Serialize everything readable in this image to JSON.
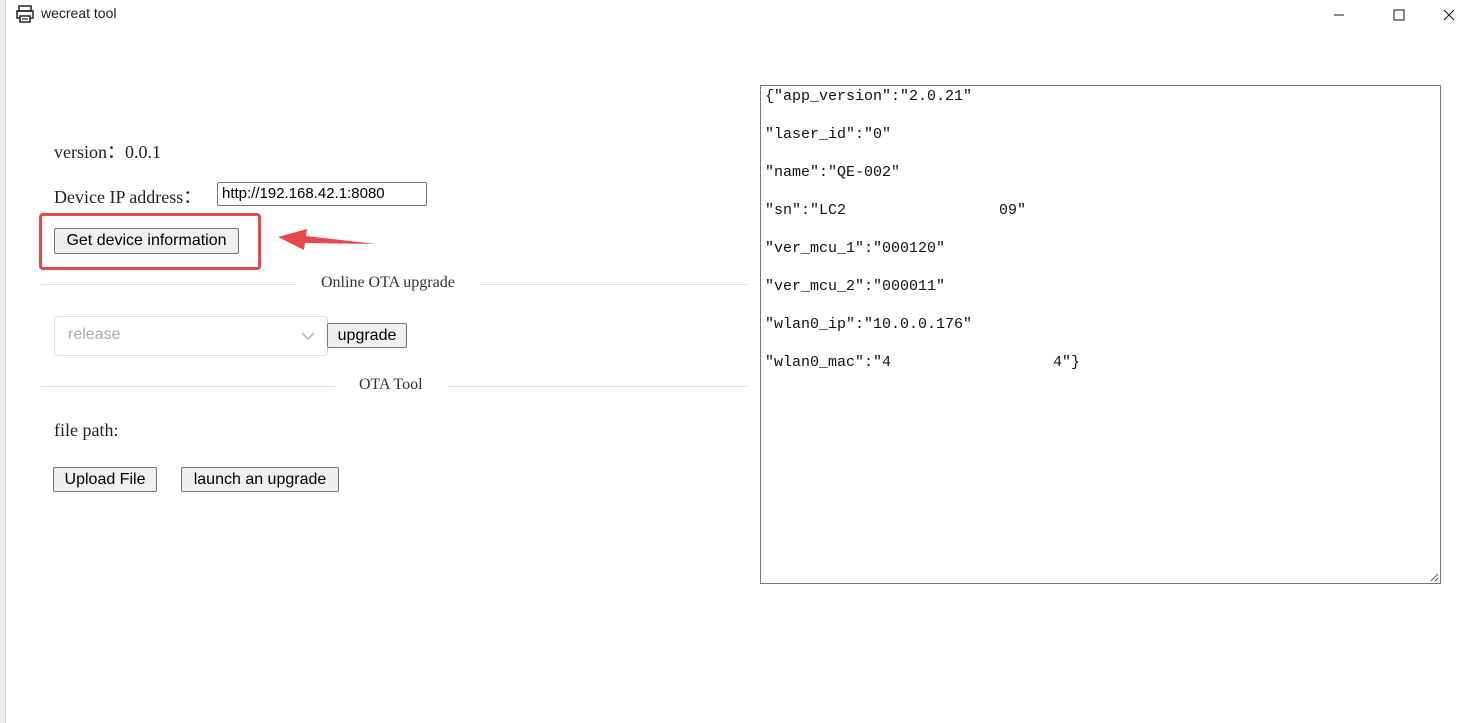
{
  "window": {
    "title": "wecreat tool"
  },
  "main": {
    "version_text": "version：0.0.1",
    "ip_label": "Device IP address：",
    "ip_value": "http://192.168.42.1:8080",
    "get_info_label": "Get device information",
    "online_ota_title": "Online OTA upgrade",
    "channel_select_value": "release",
    "upgrade_label": "upgrade",
    "ota_tool_title": "OTA Tool",
    "file_path_label": "file path:",
    "upload_label": "Upload File",
    "launch_label": "launch an upgrade"
  },
  "device_info": {
    "lines": [
      "{\"app_version\":\"2.0.21\"",
      "\"laser_id\":\"0\"",
      "\"name\":\"QE-002\"",
      "\"sn\":\"LC2                 09\"",
      "\"ver_mcu_1\":\"000120\"",
      "\"ver_mcu_2\":\"000011\"",
      "\"wlan0_ip\":\"10.0.0.176\"",
      "\"wlan0_mac\":\"4                  4\"}"
    ]
  },
  "colors": {
    "highlight": "#e8474b",
    "divider": "#dcdfe6"
  },
  "icons": {
    "app": "printer-icon",
    "minimize": "minimize-icon",
    "maximize": "maximize-icon",
    "close": "close-icon",
    "select": "chevron-down-icon",
    "annotation": "arrow-left-icon"
  }
}
